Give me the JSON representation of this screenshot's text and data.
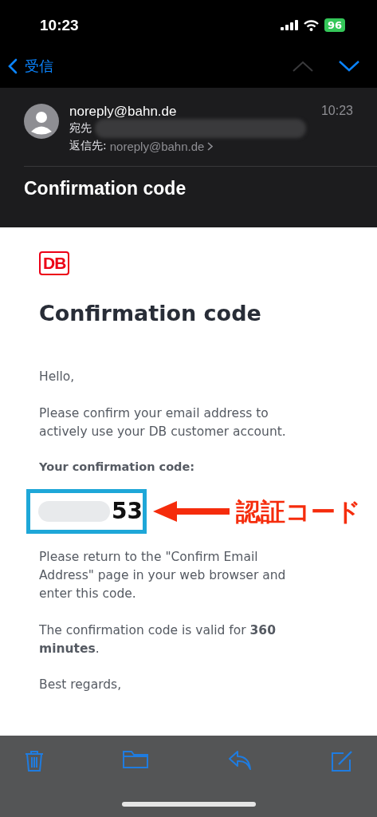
{
  "status_bar": {
    "time": "10:23",
    "battery": "96"
  },
  "nav": {
    "back_label": "受信"
  },
  "header": {
    "sender": "noreply@bahn.de",
    "time": "10:23",
    "to_label": "宛先",
    "reply_to_label": "返信先:",
    "reply_to": "noreply@bahn.de",
    "subject": "Confirmation code"
  },
  "body": {
    "logo": "DB",
    "title": "Confirmation code",
    "paragraphs": [
      {
        "kind": "text",
        "text": "Hello,"
      },
      {
        "kind": "text",
        "text": "Please confirm your email address to actively use your DB customer account."
      },
      {
        "kind": "label",
        "text": "Your confirmation code:"
      },
      {
        "kind": "code",
        "text": "53",
        "annotation": "認証コード"
      },
      {
        "kind": "text",
        "text": "Please return to the \"Confirm Email Address\" page in your web browser and enter this code."
      },
      {
        "kind": "text",
        "text": "The confirmation code is valid for **360 minutes**."
      },
      {
        "kind": "text",
        "text": "Best regards,"
      }
    ]
  }
}
